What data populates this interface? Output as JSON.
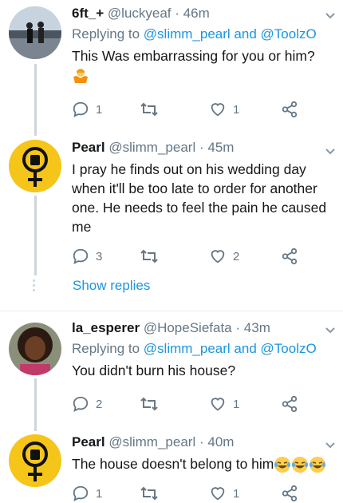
{
  "tweets": [
    {
      "name": "6ft_+",
      "handle": "@luckyeaf",
      "time": "46m",
      "reply_prefix": "Replying to",
      "reply_mention_1": "@slimm_pearl",
      "reply_and": "and",
      "reply_mention_2": "@ToolzO",
      "text": "This Was embarrassing for you or him?",
      "replies": "1",
      "likes": "1"
    },
    {
      "name": "Pearl",
      "handle": "@slimm_pearl",
      "time": "45m",
      "text": "I pray he finds out on his wedding day when it'll be too late to order for another one. He needs to feel the pain he caused me",
      "replies": "3",
      "likes": "2",
      "show_replies": "Show replies"
    },
    {
      "name": "la_esperer",
      "handle": "@HopeSiefata",
      "time": "43m",
      "reply_prefix": "Replying to",
      "reply_mention_1": "@slimm_pearl",
      "reply_and": "and",
      "reply_mention_2": "@ToolzO",
      "text": "You didn't burn his house?",
      "replies": "2",
      "likes": "1"
    },
    {
      "name": "Pearl",
      "handle": "@slimm_pearl",
      "time": "40m",
      "text": "The house doesn't belong to him",
      "replies": "1",
      "likes": "1"
    }
  ],
  "separator": "·",
  "colors": {
    "link": "#1b95e0",
    "muted": "#657786",
    "pearl_avatar_bg": "#f5c519"
  },
  "icons": [
    "reply-icon",
    "retweet-icon",
    "like-icon",
    "share-icon",
    "chevron-down-icon",
    "feminist-fist-icon",
    "shrug-emoji",
    "laughing-emoji"
  ]
}
